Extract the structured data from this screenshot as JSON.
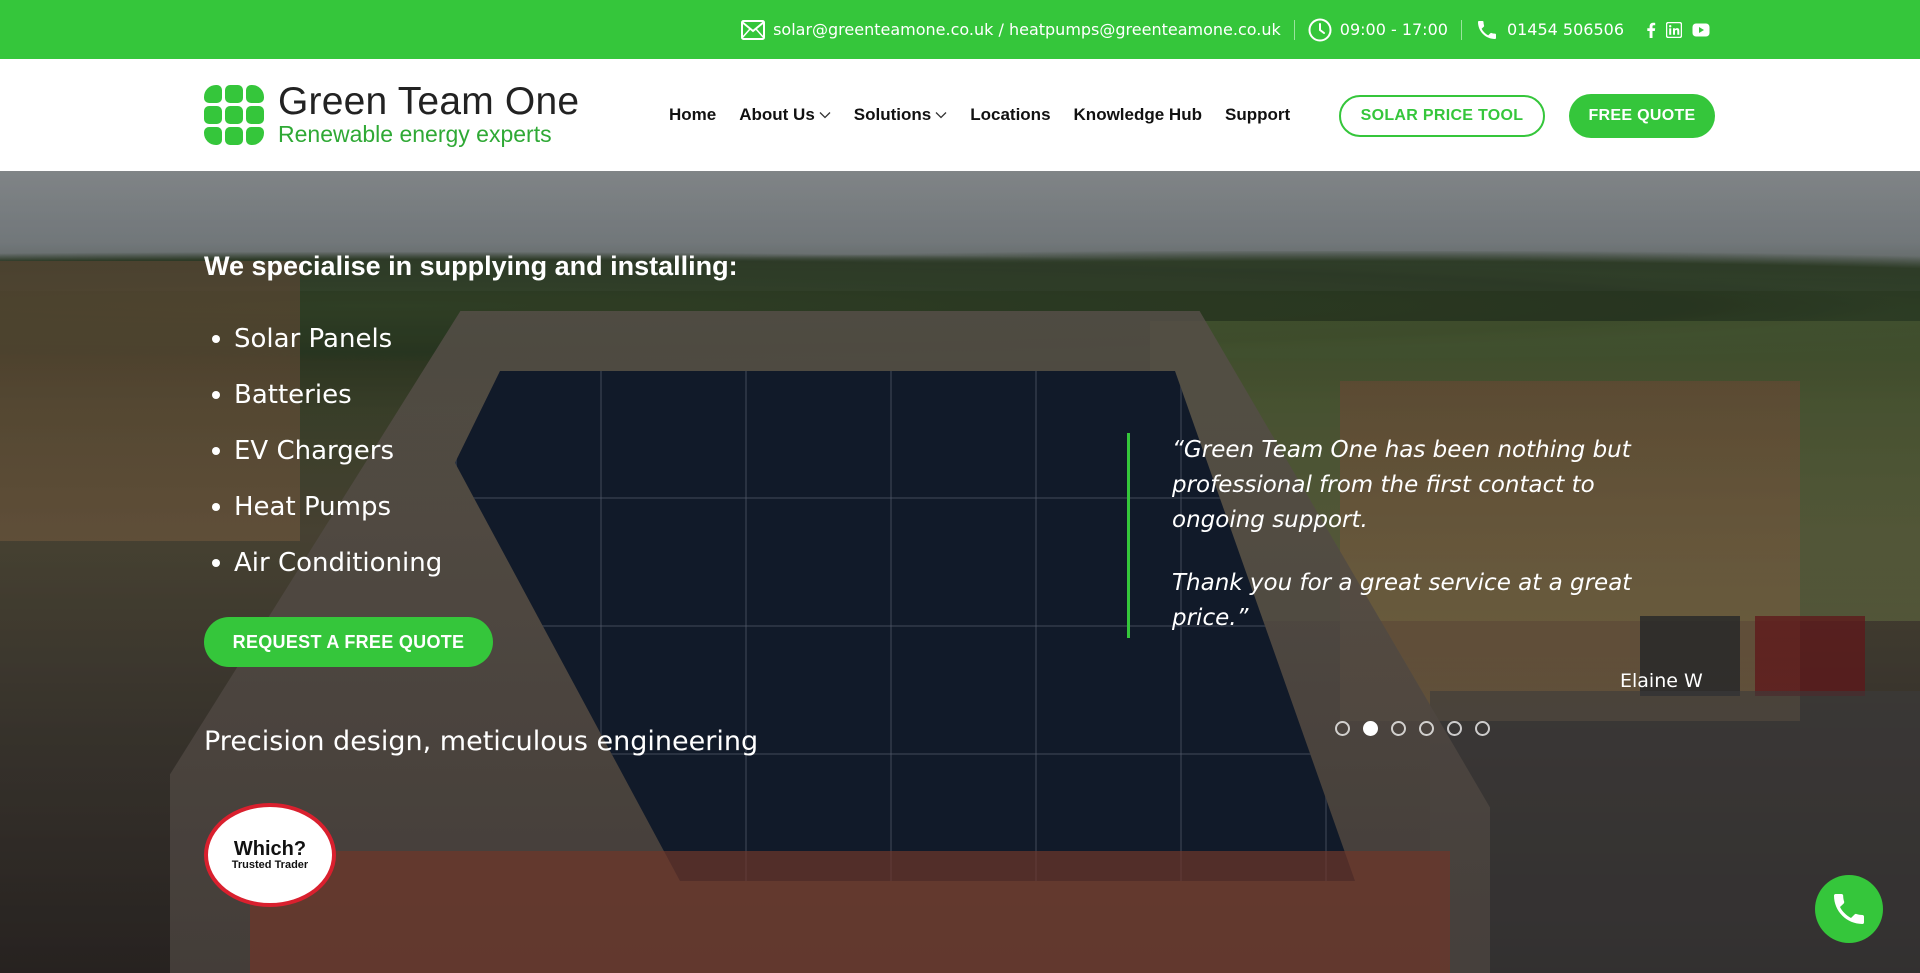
{
  "topbar": {
    "emails": "solar@greenteamone.co.uk / heatpumps@greenteamone.co.uk",
    "hours": "09:00 - 17:00",
    "phone": "01454 506506",
    "social_icons": [
      "facebook-icon",
      "linkedin-icon",
      "youtube-icon"
    ]
  },
  "brand": {
    "name": "Green Team One",
    "tagline": "Renewable energy experts",
    "primary_color": "#35c63b"
  },
  "nav": {
    "items": [
      {
        "label": "Home",
        "dropdown": false
      },
      {
        "label": "About Us",
        "dropdown": true
      },
      {
        "label": "Solutions",
        "dropdown": true
      },
      {
        "label": "Locations",
        "dropdown": false
      },
      {
        "label": "Knowledge Hub",
        "dropdown": false
      },
      {
        "label": "Support",
        "dropdown": false
      }
    ],
    "solar_tool_label": "SOLAR PRICE TOOL",
    "free_quote_label": "FREE QUOTE"
  },
  "hero": {
    "heading": "We specialise in supplying and installing:",
    "services": [
      "Solar Panels",
      "Batteries",
      "EV Chargers",
      "Heat Pumps",
      "Air Conditioning"
    ],
    "cta_label": "REQUEST A FREE QUOTE",
    "tagline": "Precision design, meticulous engineering",
    "badge": {
      "name": "Which?",
      "subtitle": "Trusted Trader"
    }
  },
  "testimonial": {
    "quote_part1": "“Green Team One has been nothing but professional from the first contact to ongoing support.",
    "quote_part2": "Thank you for a great service at a great price.”",
    "author": "Elaine W",
    "slide_count": 6,
    "active_slide": 2
  }
}
